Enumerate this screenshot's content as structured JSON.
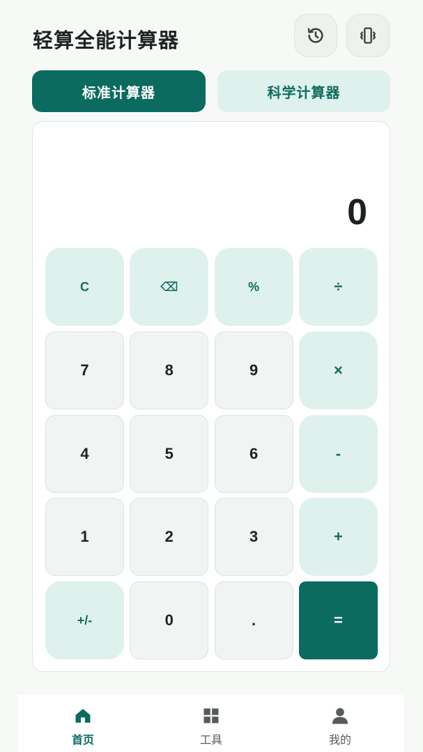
{
  "header": {
    "title": "轻算全能计算器",
    "history_icon": "history-icon",
    "vibrate_icon": "vibrate-icon"
  },
  "mode_tabs": [
    {
      "label": "标准计算器",
      "active": true
    },
    {
      "label": "科学计算器",
      "active": false
    }
  ],
  "display": {
    "value": "0"
  },
  "keypad": {
    "rows": [
      [
        "C",
        "⌫",
        "%",
        "÷"
      ],
      [
        "7",
        "8",
        "9",
        "×"
      ],
      [
        "4",
        "5",
        "6",
        "-"
      ],
      [
        "1",
        "2",
        "3",
        "+"
      ],
      [
        "+/-",
        "0",
        ".",
        "="
      ]
    ]
  },
  "bottom_nav": [
    {
      "label": "首页",
      "icon": "home-icon",
      "active": true
    },
    {
      "label": "工具",
      "icon": "grid-icon",
      "active": false
    },
    {
      "label": "我的",
      "icon": "user-icon",
      "active": false
    }
  ],
  "colors": {
    "primary": "#0a6b5e",
    "accent_light": "#dff1ec",
    "background": "#f7f9f6",
    "key_number": "#f0f4f2"
  }
}
